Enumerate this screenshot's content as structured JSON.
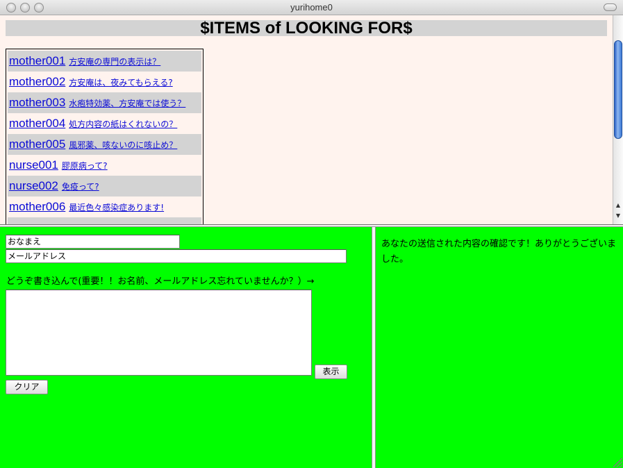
{
  "window": {
    "title": "yurihome0"
  },
  "top_frame": {
    "heading": "$ITEMS of LOOKING FOR$",
    "links": [
      {
        "id": "mother001",
        "text": "方安庵の専門の表示は？"
      },
      {
        "id": "mother002",
        "text": "方安庵は、夜みてもらえる?"
      },
      {
        "id": "mother003",
        "text": "水疱特効薬、方安庵では使う？"
      },
      {
        "id": "mother004",
        "text": "処方内容の紙はくれないの？"
      },
      {
        "id": "mother005",
        "text": "風邪薬、咳ないのに咳止め？"
      },
      {
        "id": "nurse001",
        "text": "膠原病って?"
      },
      {
        "id": "nurse002",
        "text": "免疫って?"
      },
      {
        "id": "mother006",
        "text": "最近色々感染症あります!"
      }
    ]
  },
  "form": {
    "name_value": "おなまえ",
    "email_value": "メールアドレス",
    "prompt": "どうぞ書き込んで(重要！！お名前、メールアドレス忘れていませんか？）→",
    "message_value": "",
    "show_button": "表示",
    "clear_button": "クリア"
  },
  "confirmation": {
    "text": "あなたの送信された内容の確認です！ありがとうございました。"
  },
  "colors": {
    "form_background": "#00ff00",
    "top_background": "#fff3ee",
    "heading_bar": "#d3d3d3",
    "link": "#0a0ad6"
  }
}
